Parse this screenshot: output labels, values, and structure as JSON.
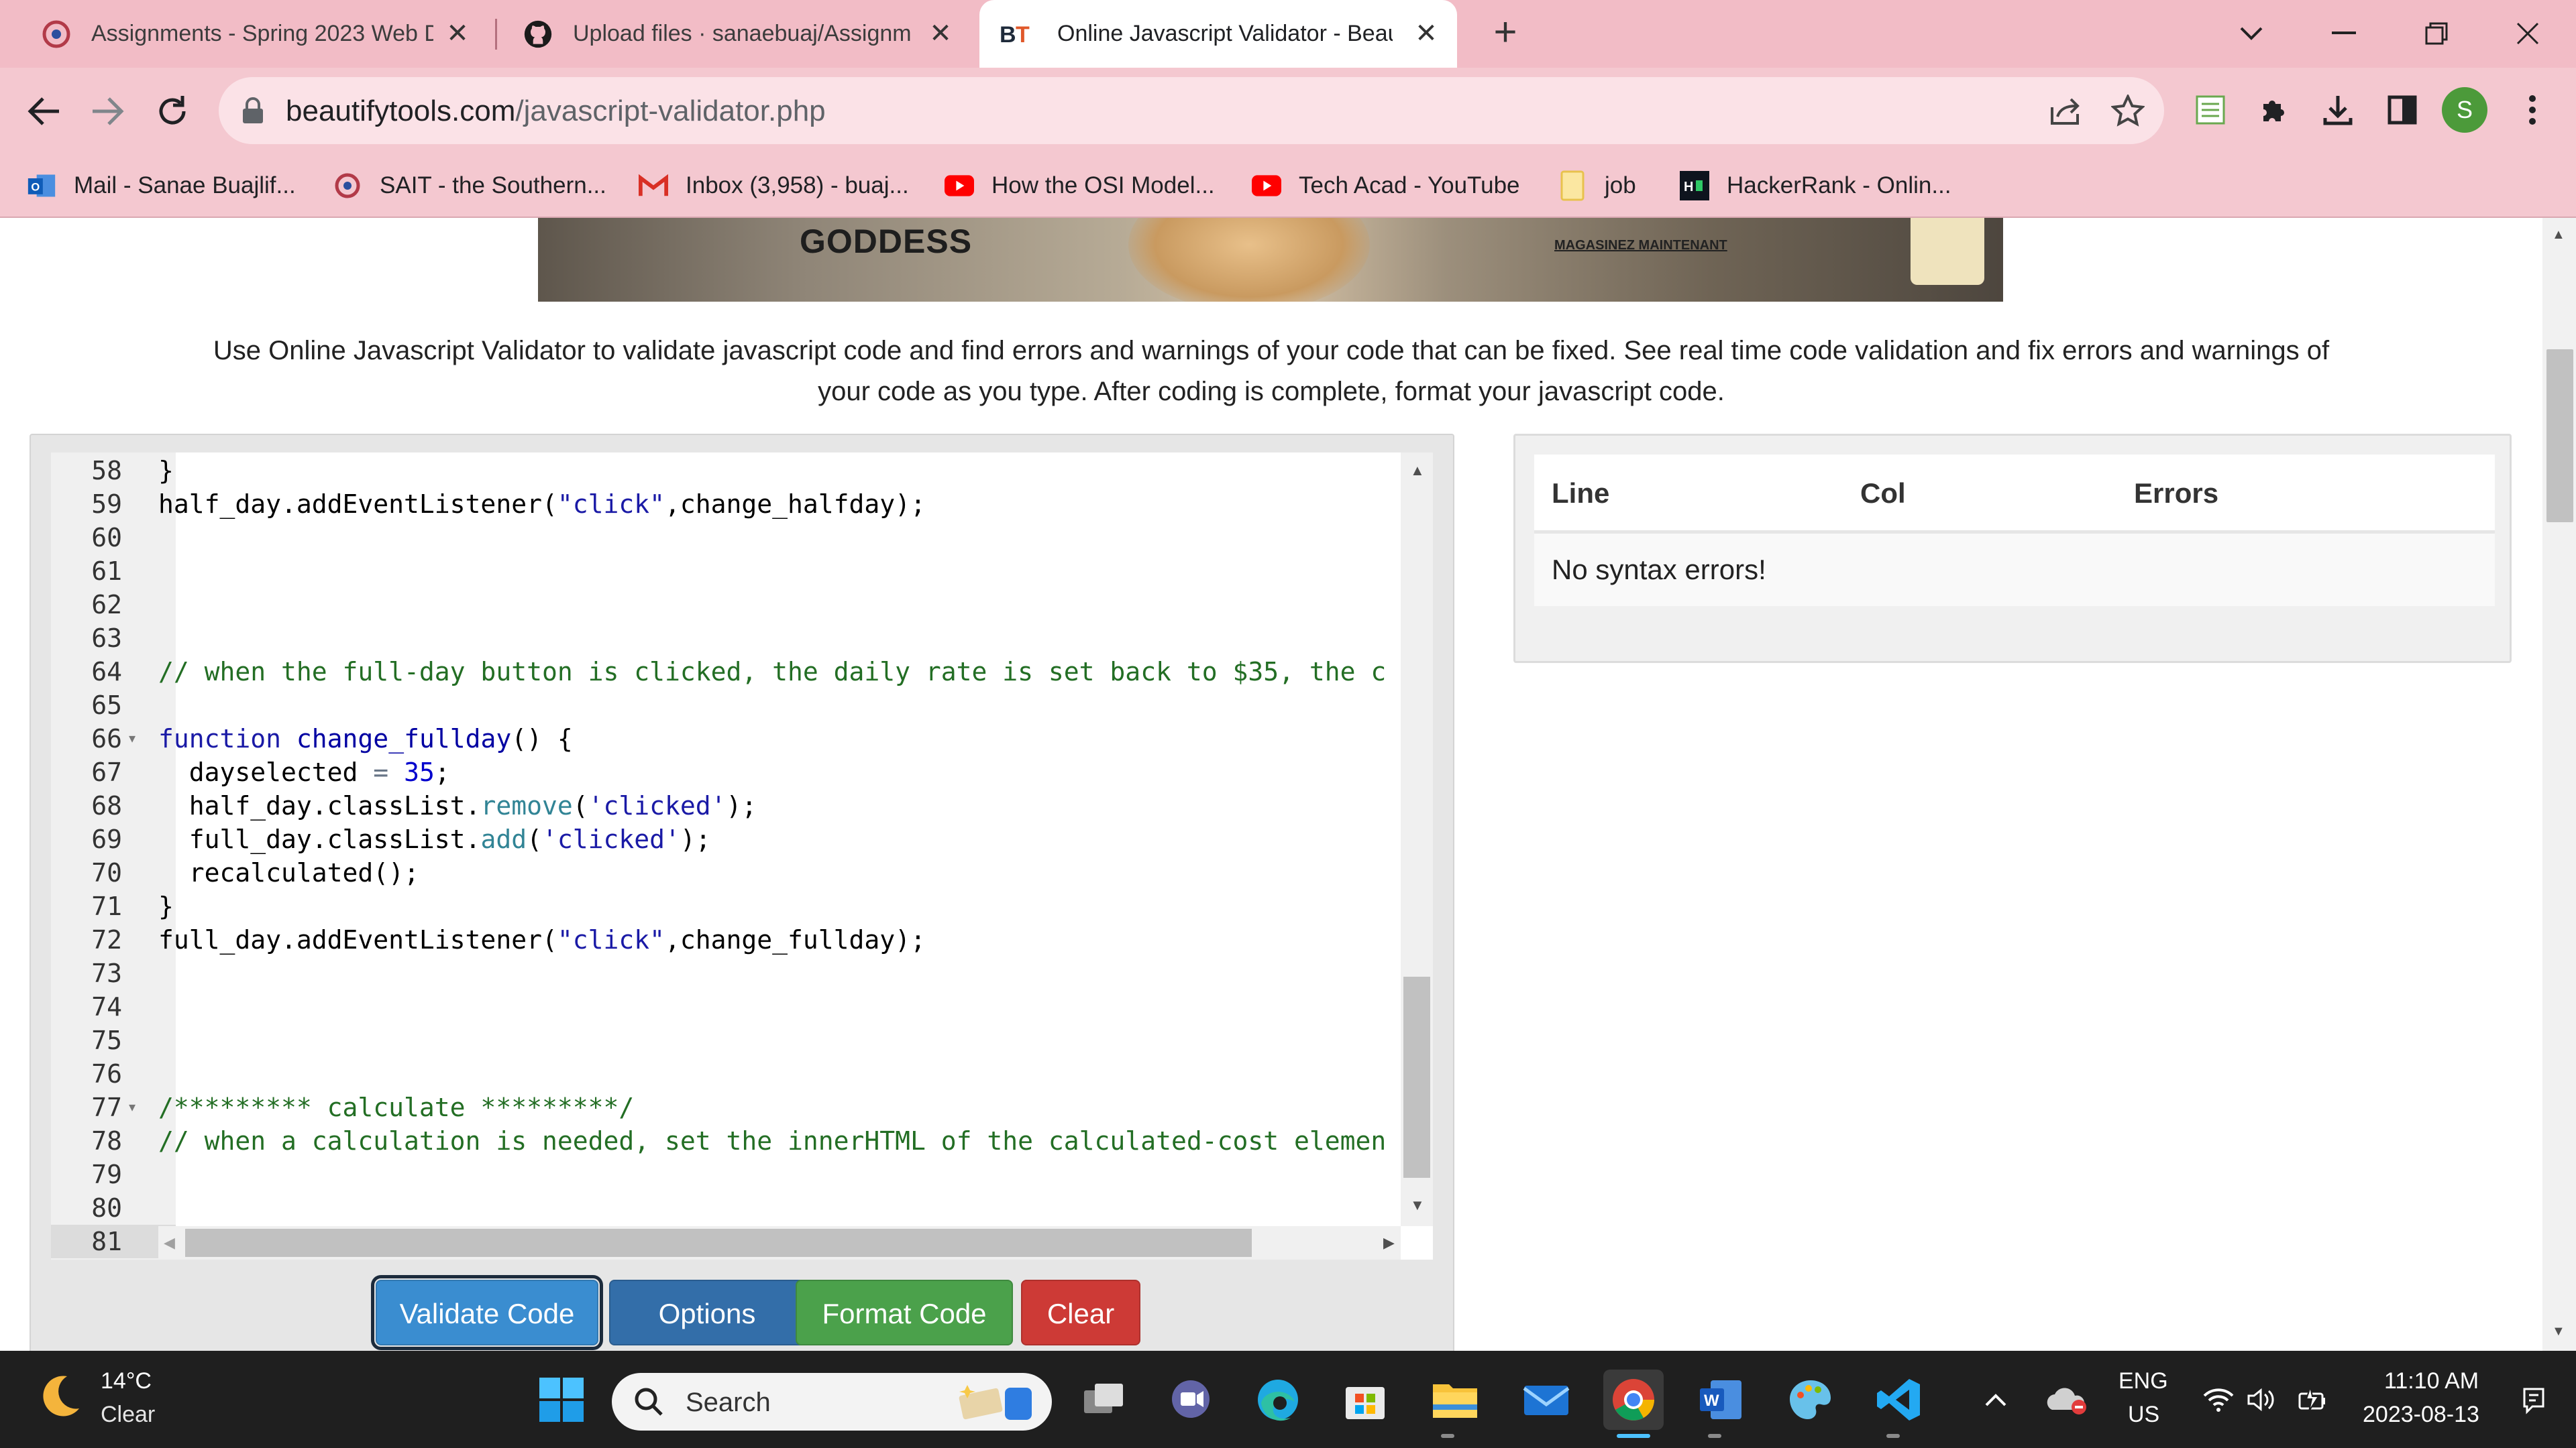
{
  "browser": {
    "tabs": [
      {
        "title": "Assignments - Spring 2023 Web D"
      },
      {
        "title": "Upload files · sanaebuaj/Assignm"
      },
      {
        "title": "Online Javascript Validator - Beau"
      }
    ],
    "url_host": "beautifytools.com",
    "url_path": "/javascript-validator.php",
    "avatar_letter": "S",
    "bookmarks": [
      {
        "label": "Mail - Sanae Buajlif..."
      },
      {
        "label": "SAIT - the Southern..."
      },
      {
        "label": "Inbox (3,958) - buaj..."
      },
      {
        "label": "How the OSI Model..."
      },
      {
        "label": "Tech Acad - YouTube"
      },
      {
        "label": "job"
      },
      {
        "label": "HackerRank - Onlin..."
      }
    ]
  },
  "ad": {
    "headline": "GODDESS",
    "cta": "MAGASINEZ MAINTENANT"
  },
  "page": {
    "description": "Use Online Javascript Validator to validate javascript code and find errors and warnings of your code that can be fixed. See real time code validation and fix errors and warnings of your code as you type. After coding is complete, format your javascript code.",
    "buttons": {
      "validate": "Validate Code",
      "options": "Options",
      "format": "Format Code",
      "clear": "Clear"
    },
    "results": {
      "headers": {
        "line": "Line",
        "col": "Col",
        "errors": "Errors"
      },
      "message": "No syntax errors!"
    }
  },
  "editor": {
    "lines": [
      {
        "n": "58",
        "text": "}"
      },
      {
        "n": "59",
        "text": "half_day.addEventListener(\"click\",change_halfday);"
      },
      {
        "n": "60",
        "text": ""
      },
      {
        "n": "61",
        "text": ""
      },
      {
        "n": "62",
        "text": ""
      },
      {
        "n": "63",
        "text": ""
      },
      {
        "n": "64",
        "text": "// when the full-day button is clicked, the daily rate is set back to $35, the c"
      },
      {
        "n": "65",
        "text": ""
      },
      {
        "n": "66",
        "text": "function change_fullday() {"
      },
      {
        "n": "67",
        "text": "  dayselected = 35;"
      },
      {
        "n": "68",
        "text": "  half_day.classList.remove('clicked');"
      },
      {
        "n": "69",
        "text": "  full_day.classList.add('clicked');"
      },
      {
        "n": "70",
        "text": "  recalculated();"
      },
      {
        "n": "71",
        "text": "}"
      },
      {
        "n": "72",
        "text": "full_day.addEventListener(\"click\",change_fullday);"
      },
      {
        "n": "73",
        "text": ""
      },
      {
        "n": "74",
        "text": ""
      },
      {
        "n": "75",
        "text": ""
      },
      {
        "n": "76",
        "text": ""
      },
      {
        "n": "77",
        "text": "/********* calculate *********/"
      },
      {
        "n": "78",
        "text": "// when a calculation is needed, set the innerHTML of the calculated-cost elemen"
      },
      {
        "n": "79",
        "text": ""
      },
      {
        "n": "80",
        "text": ""
      },
      {
        "n": "81",
        "text": ""
      }
    ],
    "fold_lines": [
      "66",
      "77"
    ],
    "active_line": "81"
  },
  "taskbar": {
    "temp": "14°C",
    "weather": "Clear",
    "search": "Search",
    "lang": "ENG",
    "region": "US",
    "time": "11:10 AM",
    "date": "2023-08-13"
  },
  "colors": {
    "tabstrip": "#f2bcc6",
    "toolbar": "#f4c8d0",
    "validate": "#3a8dd0",
    "options": "#336ea9",
    "format": "#4ba14b",
    "clear": "#cd3a36"
  }
}
